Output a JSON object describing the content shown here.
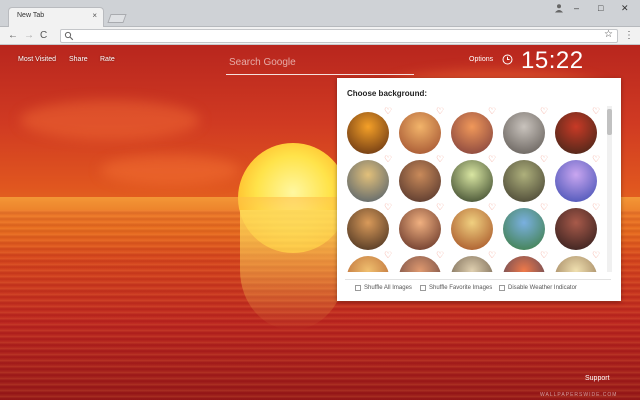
{
  "browser": {
    "tab_title": "New Tab",
    "tab_close": "×",
    "window_minimize": "–",
    "window_maximize": "□",
    "window_close": "✕",
    "nav_back": "←",
    "nav_forward": "→",
    "nav_reload": "C",
    "bookmark_star": "☆",
    "menu": "⋮"
  },
  "page": {
    "links": {
      "most_visited": "Most Visited",
      "share": "Share",
      "rate": "Rate"
    },
    "search_placeholder": "Search Google",
    "options": "Options",
    "clock": "15:22",
    "support": "Support",
    "watermark": "WALLPAPERSWIDE.COM"
  },
  "panel": {
    "title": "Choose background:",
    "thumbnails": [
      {
        "colors": [
          "#f4a028",
          "#5a2a10"
        ]
      },
      {
        "colors": [
          "#f2b46a",
          "#9b4a2c"
        ]
      },
      {
        "colors": [
          "#f0985a",
          "#7a3a3a"
        ]
      },
      {
        "colors": [
          "#c9c3bd",
          "#5b5550"
        ]
      },
      {
        "colors": [
          "#c83a26",
          "#3a2418"
        ]
      },
      {
        "colors": [
          "#e2c07a",
          "#4a5a6a"
        ]
      },
      {
        "colors": [
          "#c98a5a",
          "#4a2e28"
        ]
      },
      {
        "colors": [
          "#d9e6a2",
          "#2e3a22"
        ]
      },
      {
        "colors": [
          "#aeb07c",
          "#3e3a2c"
        ]
      },
      {
        "colors": [
          "#c9a6f0",
          "#3a4ab0"
        ]
      },
      {
        "colors": [
          "#d99a5a",
          "#3e2a1c"
        ]
      },
      {
        "colors": [
          "#f0b080",
          "#5a2a20"
        ]
      },
      {
        "colors": [
          "#f0d080",
          "#a04a20"
        ]
      },
      {
        "colors": [
          "#7ab0e0",
          "#3a7a3a"
        ]
      },
      {
        "colors": [
          "#a85a4a",
          "#2a1a1a"
        ]
      },
      {
        "colors": [
          "#f0c070",
          "#b05a2a"
        ]
      },
      {
        "colors": [
          "#e09a70",
          "#5a3a3a"
        ]
      },
      {
        "colors": [
          "#e0d0b0",
          "#5a4a3a"
        ]
      },
      {
        "colors": [
          "#f07a4a",
          "#3a3a5a"
        ]
      },
      {
        "colors": [
          "#f0e0b0",
          "#8a6a4a"
        ]
      }
    ],
    "options": {
      "shuffle_all": "Shuffle All Images",
      "shuffle_favorite": "Shuffle Favorite Images",
      "disable_weather": "Disable Weather Indicator"
    }
  }
}
